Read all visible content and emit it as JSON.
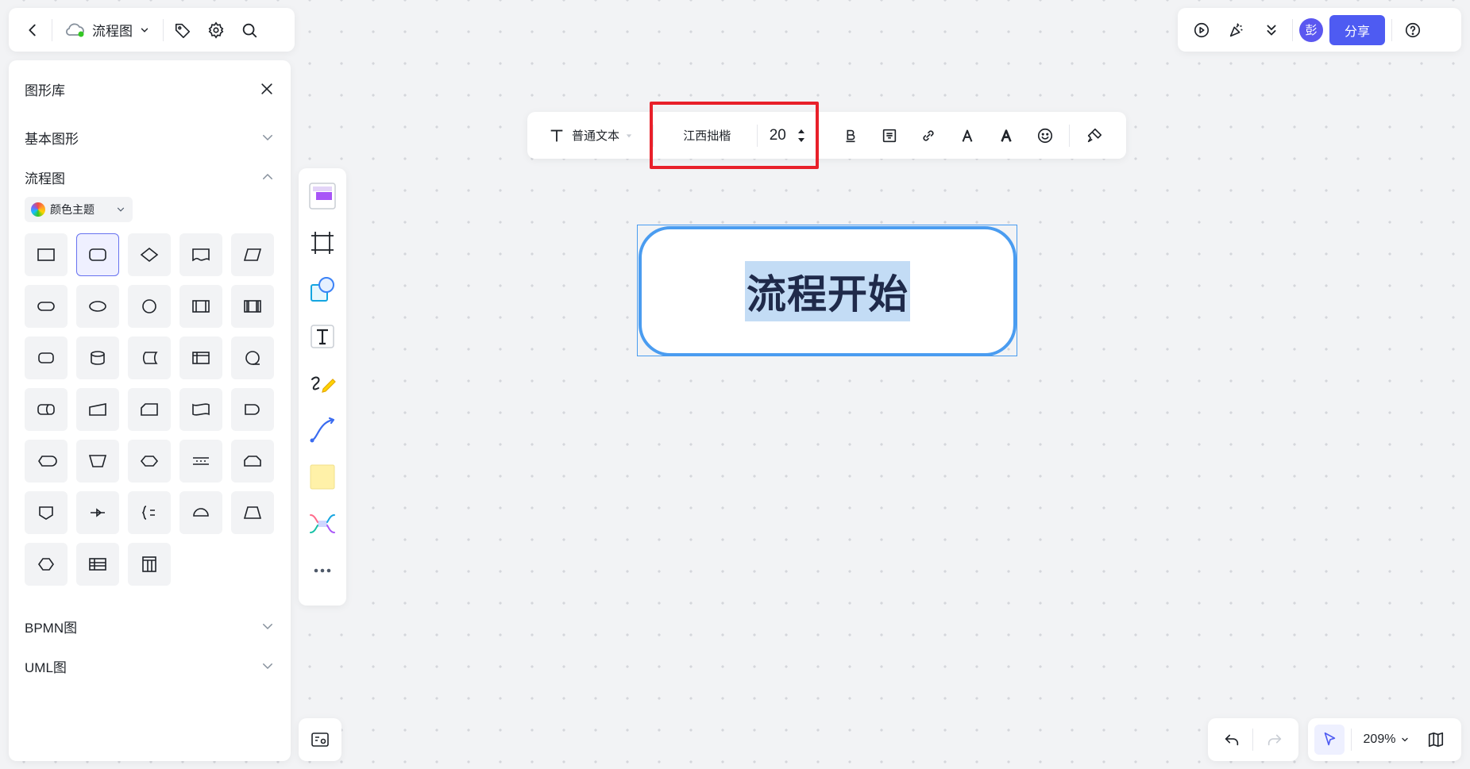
{
  "header": {
    "doc_title": "流程图",
    "share_label": "分享",
    "avatar_text": "彭"
  },
  "shape_library": {
    "title": "图形库",
    "sections": {
      "basic": "基本图形",
      "flowchart": "流程图",
      "bpmn": "BPMN图",
      "uml": "UML图"
    },
    "color_theme_label": "颜色主题"
  },
  "text_toolbar": {
    "text_style": "普通文本",
    "font_name": "江西拙楷",
    "font_size": "20"
  },
  "canvas": {
    "node_text": "流程开始"
  },
  "zoom": {
    "level": "209%"
  },
  "colors": {
    "accent": "#4e5bf2",
    "selection": "#4a9cf0",
    "highlight_box": "#e8202a",
    "text_highlight": "#c3dcf5"
  }
}
